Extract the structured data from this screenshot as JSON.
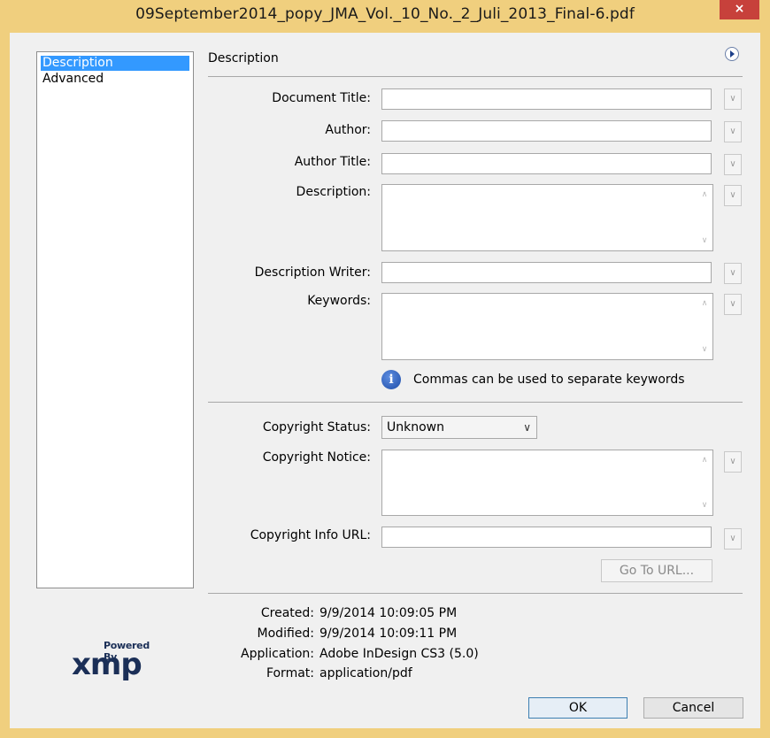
{
  "window": {
    "title": "09September2014_popy_JMA_Vol._10_No._2_Juli_2013_Final-6.pdf",
    "close_glyph": "×"
  },
  "sidebar": {
    "items": [
      {
        "label": "Description",
        "selected": true
      },
      {
        "label": "Advanced",
        "selected": false
      }
    ]
  },
  "section": {
    "title": "Description"
  },
  "form": {
    "document_title": {
      "label": "Document Title:",
      "value": ""
    },
    "author": {
      "label": "Author:",
      "value": ""
    },
    "author_title": {
      "label": "Author Title:",
      "value": ""
    },
    "description": {
      "label": "Description:",
      "value": ""
    },
    "description_writer": {
      "label": "Description Writer:",
      "value": ""
    },
    "keywords": {
      "label": "Keywords:",
      "value": ""
    },
    "keywords_hint": "Commas can be used to separate keywords",
    "copyright_status": {
      "label": "Copyright Status:",
      "value": "Unknown"
    },
    "copyright_notice": {
      "label": "Copyright Notice:",
      "value": ""
    },
    "copyright_url": {
      "label": "Copyright Info URL:",
      "value": ""
    },
    "go_to_url": "Go To URL..."
  },
  "metadata": {
    "created": {
      "label": "Created:",
      "value": "9/9/2014 10:09:05 PM"
    },
    "modified": {
      "label": "Modified:",
      "value": "9/9/2014 10:09:11 PM"
    },
    "application": {
      "label": "Application:",
      "value": "Adobe InDesign CS3 (5.0)"
    },
    "format": {
      "label": "Format:",
      "value": "application/pdf"
    }
  },
  "branding": {
    "powered_by": "Powered By",
    "logo_text": "xmp"
  },
  "footer": {
    "ok": "OK",
    "cancel": "Cancel"
  },
  "icons": {
    "dropdown": "chevron-down-icon",
    "flyout": "flyout-menu-icon",
    "info": "info-icon",
    "close": "close-icon"
  },
  "colors": {
    "titlebar": "#f0cf7e",
    "selection": "#3399ff",
    "close": "#c7413b"
  }
}
